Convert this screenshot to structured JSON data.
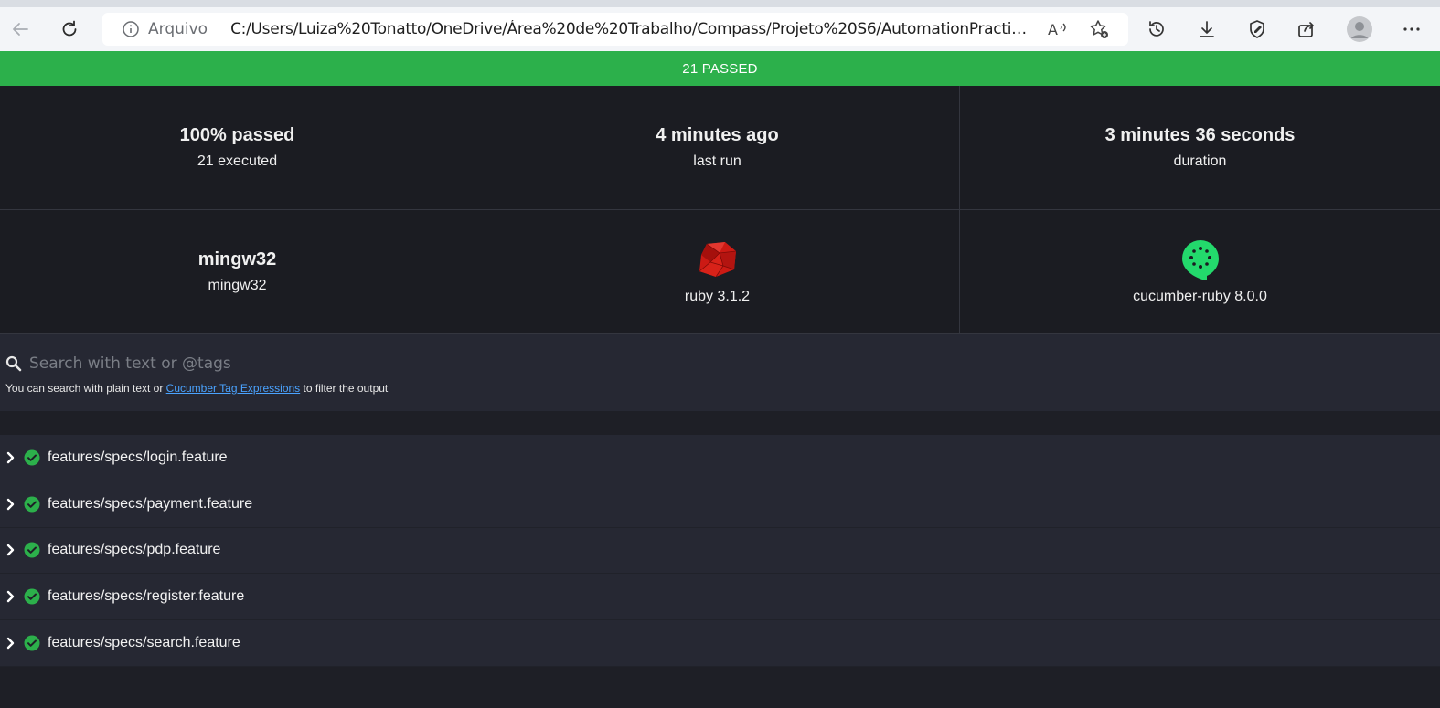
{
  "browser": {
    "address": {
      "scheme_label": "Arquivo",
      "url": "C:/Users/Luiza%20Tonatto/OneDrive/Área%20de%20Trabalho/Compass/Projeto%20S6/AutomationPractice/repo..."
    },
    "icons": [
      "back-icon",
      "refresh-icon",
      "info-icon",
      "read-aloud-icon",
      "favorite-add-icon",
      "history-icon",
      "download-icon",
      "extensions-icon",
      "share-icon",
      "profile-icon",
      "more-icon"
    ]
  },
  "report": {
    "banner": "21 PASSED",
    "colors": {
      "banner": "#2cb04b",
      "ruby": "#cc1a14",
      "cucumber": "#23d96c",
      "check": "#2cb04b"
    },
    "stats": {
      "passed": {
        "main": "100% passed",
        "sub": "21 executed"
      },
      "last_run": {
        "main": "4 minutes ago",
        "sub": "last run"
      },
      "duration": {
        "main": "3 minutes 36 seconds",
        "sub": "duration"
      },
      "os": {
        "main": "mingw32",
        "sub": "mingw32"
      },
      "runtime": {
        "sub": "ruby 3.1.2",
        "icon": "ruby-logo-icon"
      },
      "implementation": {
        "sub": "cucumber-ruby 8.0.0",
        "icon": "cucumber-logo-icon"
      }
    },
    "search": {
      "placeholder": "Search with text or @tags",
      "help_prefix": "You can search with plain text or ",
      "help_link": "Cucumber Tag Expressions",
      "help_suffix": " to filter the output"
    },
    "features": [
      "features/specs/login.feature",
      "features/specs/payment.feature",
      "features/specs/pdp.feature",
      "features/specs/register.feature",
      "features/specs/search.feature"
    ]
  }
}
